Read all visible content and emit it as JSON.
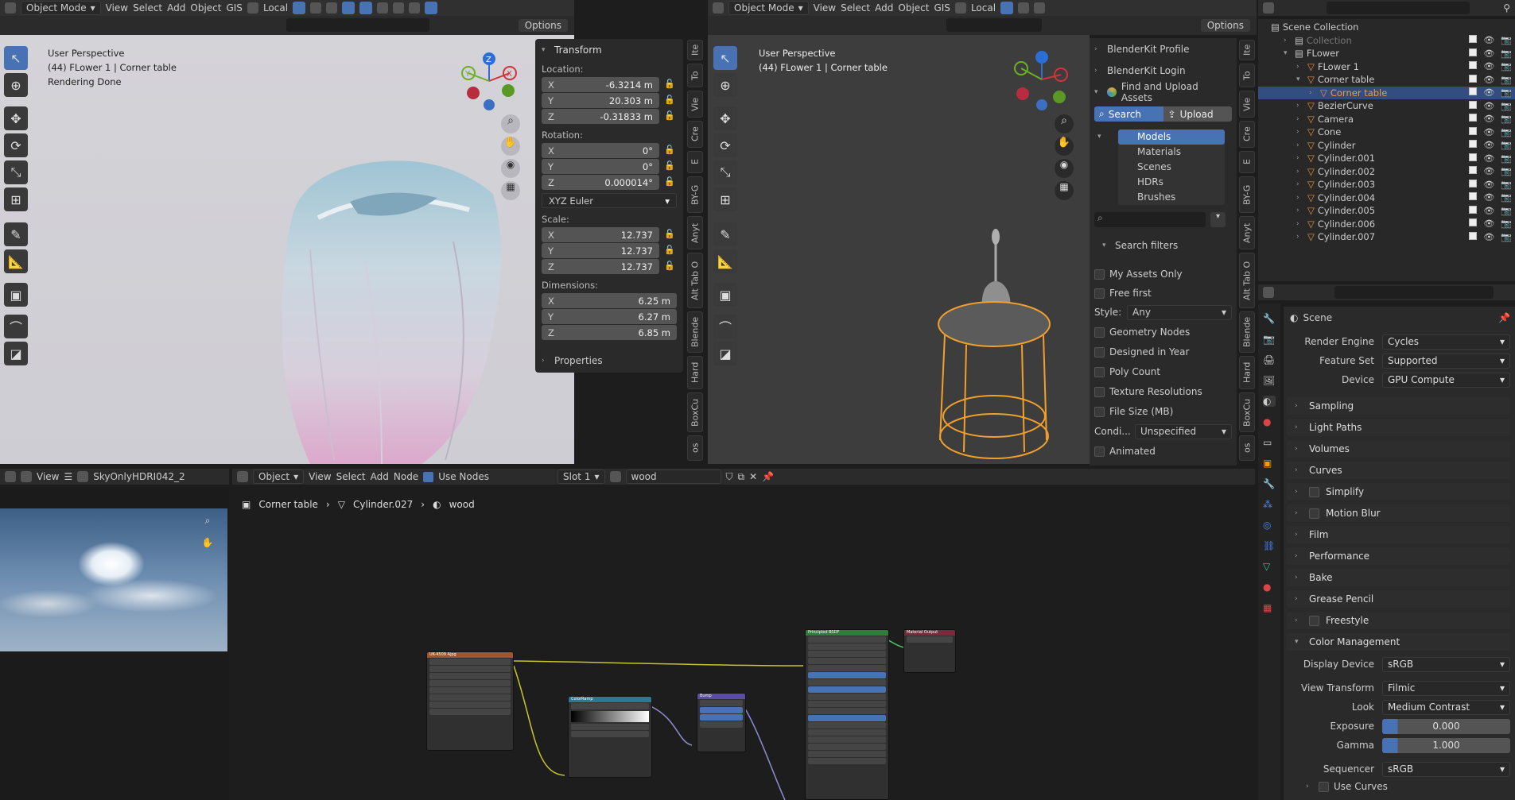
{
  "left_view": {
    "mode": "Object Mode",
    "menus": [
      "View",
      "Select",
      "Add",
      "Object",
      "GIS"
    ],
    "orientation": "Local",
    "options": "Options",
    "overlay_lines": [
      "User Perspective",
      "(44) FLower 1 | Corner table",
      "Rendering Done"
    ],
    "transform_title": "Transform",
    "location_label": "Location:",
    "location": [
      {
        "a": "X",
        "v": "-6.3214 m"
      },
      {
        "a": "Y",
        "v": "20.303 m"
      },
      {
        "a": "Z",
        "v": "-0.31833 m"
      }
    ],
    "rotation_label": "Rotation:",
    "rotation": [
      {
        "a": "X",
        "v": "0°"
      },
      {
        "a": "Y",
        "v": "0°"
      },
      {
        "a": "Z",
        "v": "0.000014°"
      }
    ],
    "rotation_mode": "XYZ Euler",
    "scale_label": "Scale:",
    "scale": [
      {
        "a": "X",
        "v": "12.737"
      },
      {
        "a": "Y",
        "v": "12.737"
      },
      {
        "a": "Z",
        "v": "12.737"
      }
    ],
    "dimensions_label": "Dimensions:",
    "dimensions": [
      {
        "a": "X",
        "v": "6.25 m"
      },
      {
        "a": "Y",
        "v": "6.27 m"
      },
      {
        "a": "Z",
        "v": "6.85 m"
      }
    ],
    "properties_label": "Properties",
    "side_tabs": [
      "Ite",
      "To",
      "Vie",
      "Cre",
      "E",
      "BY-G",
      "Anyt",
      "Alt Tab O",
      "Blende",
      "Hard",
      "BoxCu",
      "os"
    ],
    "gizmo": {
      "x": "X",
      "y": "Y",
      "z": "Z"
    }
  },
  "right_view": {
    "mode": "Object Mode",
    "menus": [
      "View",
      "Select",
      "Add",
      "Object",
      "GIS"
    ],
    "orientation": "Local",
    "options": "Options",
    "overlay_lines": [
      "User Perspective",
      "(44) FLower 1 | Corner table"
    ],
    "blenderkit_profile": "BlenderKit Profile",
    "blenderkit_login": "BlenderKit Login",
    "find_upload": "Find and Upload Assets",
    "search_tab": "Search",
    "upload_tab": "Upload",
    "asset_types": [
      "Models",
      "Materials",
      "Scenes",
      "HDRs",
      "Brushes"
    ],
    "search_filters": "Search filters",
    "filters": [
      "My Assets Only",
      "Free first"
    ],
    "style_label": "Style:",
    "style_value": "Any",
    "filters2": [
      "Geometry Nodes",
      "Designed in Year",
      "Poly Count",
      "Texture Resolutions",
      "File Size (MB)"
    ],
    "condition_label": "Condi...",
    "condition_value": "Unspecified",
    "animated": "Animated",
    "side_tabs": [
      "Ite",
      "To",
      "Vie",
      "Cre",
      "E",
      "BY-G",
      "Anyt",
      "Alt Tab O",
      "Blende",
      "Hard",
      "BoxCu",
      "os"
    ]
  },
  "outliner": {
    "root": "Scene Collection",
    "items": [
      {
        "name": "Collection",
        "indent": 1,
        "dim": true
      },
      {
        "name": "FLower",
        "indent": 1
      },
      {
        "name": "FLower 1",
        "indent": 2
      },
      {
        "name": "Corner table",
        "indent": 2
      },
      {
        "name": "Corner table",
        "indent": 3,
        "selected": true
      },
      {
        "name": "BezierCurve",
        "indent": 2
      },
      {
        "name": "Camera",
        "indent": 2
      },
      {
        "name": "Cone",
        "indent": 2
      },
      {
        "name": "Cylinder",
        "indent": 2
      },
      {
        "name": "Cylinder.001",
        "indent": 2
      },
      {
        "name": "Cylinder.002",
        "indent": 2
      },
      {
        "name": "Cylinder.003",
        "indent": 2
      },
      {
        "name": "Cylinder.004",
        "indent": 2
      },
      {
        "name": "Cylinder.005",
        "indent": 2
      },
      {
        "name": "Cylinder.006",
        "indent": 2
      },
      {
        "name": "Cylinder.007",
        "indent": 2
      }
    ]
  },
  "properties": {
    "scene": "Scene",
    "render_engine_label": "Render Engine",
    "render_engine": "Cycles",
    "feature_set_label": "Feature Set",
    "feature_set": "Supported",
    "device_label": "Device",
    "device": "GPU Compute",
    "sections": [
      "Sampling",
      "Light Paths",
      "Volumes",
      "Curves",
      "Simplify",
      "Motion Blur",
      "Film",
      "Performance",
      "Bake",
      "Grease Pencil",
      "Freestyle"
    ],
    "color_management": "Color Management",
    "display_device_label": "Display Device",
    "display_device": "sRGB",
    "view_transform_label": "View Transform",
    "view_transform": "Filmic",
    "look_label": "Look",
    "look": "Medium Contrast",
    "exposure_label": "Exposure",
    "exposure": "0.000",
    "gamma_label": "Gamma",
    "gamma": "1.000",
    "sequencer_label": "Sequencer",
    "sequencer": "sRGB",
    "use_curves": "Use Curves"
  },
  "image_editor": {
    "view": "View",
    "image_name": "SkyOnlyHDRI042_2"
  },
  "node_editor": {
    "object": "Object",
    "menus": [
      "View",
      "Select",
      "Add",
      "Node"
    ],
    "use_nodes": "Use Nodes",
    "slot": "Slot 1",
    "material": "wood",
    "breadcrumb": [
      "Corner table",
      "Cylinder.027",
      "wood"
    ],
    "nodes": {
      "image": "UK-4509 Ajpg",
      "colorramp": "ColorRamp",
      "bump": "Bump",
      "bsdf": "Principled BSDF",
      "output": "Material Output"
    }
  }
}
